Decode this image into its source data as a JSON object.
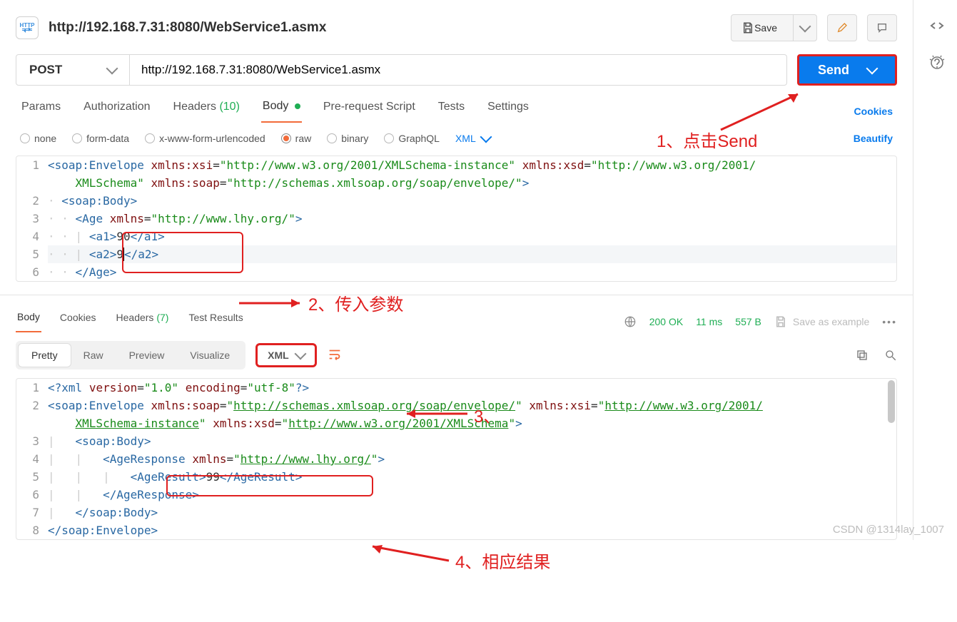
{
  "header": {
    "title": "http://192.168.7.31:8080/WebService1.asmx",
    "save_label": "Save"
  },
  "request": {
    "method": "POST",
    "url": "http://192.168.7.31:8080/WebService1.asmx",
    "send_label": "Send"
  },
  "req_tabs": {
    "params": "Params",
    "auth": "Authorization",
    "headers": "Headers",
    "headers_count": "(10)",
    "body": "Body",
    "prereq": "Pre-request Script",
    "tests": "Tests",
    "settings": "Settings",
    "cookies": "Cookies"
  },
  "body_opts": {
    "none": "none",
    "form": "form-data",
    "urlenc": "x-www-form-urlencoded",
    "raw": "raw",
    "binary": "binary",
    "graphql": "GraphQL",
    "fmt": "XML",
    "beautify": "Beautify"
  },
  "req_body_lines": [
    {
      "n": 1,
      "html": "<span class='t'>&lt;soap:Envelope</span> <span class='a'>xmlns:xsi</span>=<span class='v'>\"http://www.w3.org/2001/XMLSchema-instance\"</span> <span class='a'>xmlns:xsd</span>=<span class='v'>\"http://www.w3.org/2001/</span>"
    },
    {
      "n": "",
      "html": "    <span class='v'>XMLSchema\"</span> <span class='a'>xmlns:soap</span>=<span class='v'>\"http://schemas.xmlsoap.org/soap/envelope/\"</span><span class='t'>&gt;</span>"
    },
    {
      "n": 2,
      "html": "<span class='guide'>·</span> <span class='t'>&lt;soap:Body&gt;</span>"
    },
    {
      "n": 3,
      "html": "<span class='guide'>· ·</span> <span class='t'>&lt;Age</span> <span class='a'>xmlns</span>=<span class='v'>\"http://www.lhy.org/\"</span><span class='t'>&gt;</span>"
    },
    {
      "n": 4,
      "html": "<span class='guide'>· · |</span> <span class='t'>&lt;a1&gt;</span>90<span class='t'>&lt;/a1&gt;</span>"
    },
    {
      "n": 5,
      "html": "<span class='guide'>· · |</span> <span class='t'>&lt;a2&gt;</span>9<span style='border-left:1px solid #000'></span><span class='t'>&lt;/a2&gt;</span>"
    },
    {
      "n": 6,
      "html": "<span class='guide'>· ·</span> <span class='t'>&lt;/Age&gt;</span>"
    }
  ],
  "resp_tabs": {
    "body": "Body",
    "cookies": "Cookies",
    "headers": "Headers",
    "headers_count": "(7)",
    "tests": "Test Results",
    "status_code": "200 OK",
    "time": "11 ms",
    "size": "557 B",
    "save_example": "Save as example"
  },
  "view": {
    "pretty": "Pretty",
    "raw": "Raw",
    "preview": "Preview",
    "visualize": "Visualize",
    "fmt": "XML"
  },
  "resp_body_lines": [
    {
      "n": 1,
      "html": "<span class='t'>&lt;?xml</span> <span class='a'>version</span>=<span class='v'>\"1.0\"</span> <span class='a'>encoding</span>=<span class='v'>\"utf-8\"</span><span class='t'>?&gt;</span>"
    },
    {
      "n": 2,
      "html": "<span class='t'>&lt;soap:Envelope</span> <span class='a'>xmlns:soap</span>=<span class='v'>\"<span class='link'>http://schemas.xmlsoap.org/soap/envelope/</span>\"</span> <span class='a'>xmlns:xsi</span>=<span class='v'>\"<span class='link'>http://www.w3.org/2001/</span></span>"
    },
    {
      "n": "",
      "html": "    <span class='v'><span class='link'>XMLSchema-instance</span>\"</span> <span class='a'>xmlns:xsd</span>=<span class='v'>\"<span class='link'>http://www.w3.org/2001/XMLSchema</span>\"</span><span class='t'>&gt;</span>"
    },
    {
      "n": 3,
      "html": "<span class='guide'>|</span>   <span class='t'>&lt;soap:Body&gt;</span>"
    },
    {
      "n": 4,
      "html": "<span class='guide'>|   |</span>   <span class='t'>&lt;AgeResponse</span> <span class='a'>xmlns</span>=<span class='v'>\"<span class='link'>http://www.lhy.org/</span>\"</span><span class='t'>&gt;</span>"
    },
    {
      "n": 5,
      "html": "<span class='guide'>|   |   |</span>   <span class='t'>&lt;AgeResult&gt;</span>99<span class='t'>&lt;/AgeResult&gt;</span>"
    },
    {
      "n": 6,
      "html": "<span class='guide'>|   |</span>   <span class='t'>&lt;/AgeResponse&gt;</span>"
    },
    {
      "n": 7,
      "html": "<span class='guide'>|</span>   <span class='t'>&lt;/soap:Body&gt;</span>"
    },
    {
      "n": 8,
      "html": "<span class='t'>&lt;/soap:Envelope&gt;</span>"
    }
  ],
  "annotations": {
    "a1": "1、点击Send",
    "a2": "2、传入参数",
    "a3": "3、",
    "a4": "4、相应结果"
  },
  "watermark": "CSDN @1314lay_1007"
}
